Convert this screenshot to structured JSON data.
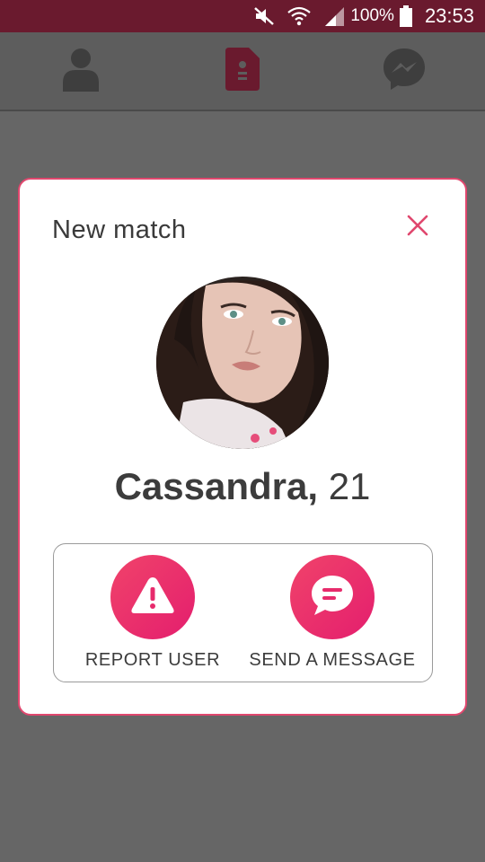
{
  "status_bar": {
    "battery_percent": "100%",
    "time": "23:53",
    "icons": [
      "mute-icon",
      "wifi-icon",
      "signal-icon",
      "battery-icon"
    ]
  },
  "nav": {
    "items": [
      {
        "icon": "profile-icon",
        "active": false
      },
      {
        "icon": "contact-card-icon",
        "active": true
      },
      {
        "icon": "messenger-icon",
        "active": false
      }
    ]
  },
  "modal": {
    "title": "New match",
    "close_icon": "close-icon",
    "match": {
      "name": "Cassandra,",
      "age": "21"
    },
    "actions": {
      "report_label": "REPORT USER",
      "report_icon": "warning-icon",
      "message_label": "SEND A MESSAGE",
      "message_icon": "chat-bubble-icon"
    }
  },
  "colors": {
    "accent": "#e41e6e",
    "status_bar": "#6a1a2e",
    "overlay": "#666666",
    "modal_border": "#e0476e"
  }
}
